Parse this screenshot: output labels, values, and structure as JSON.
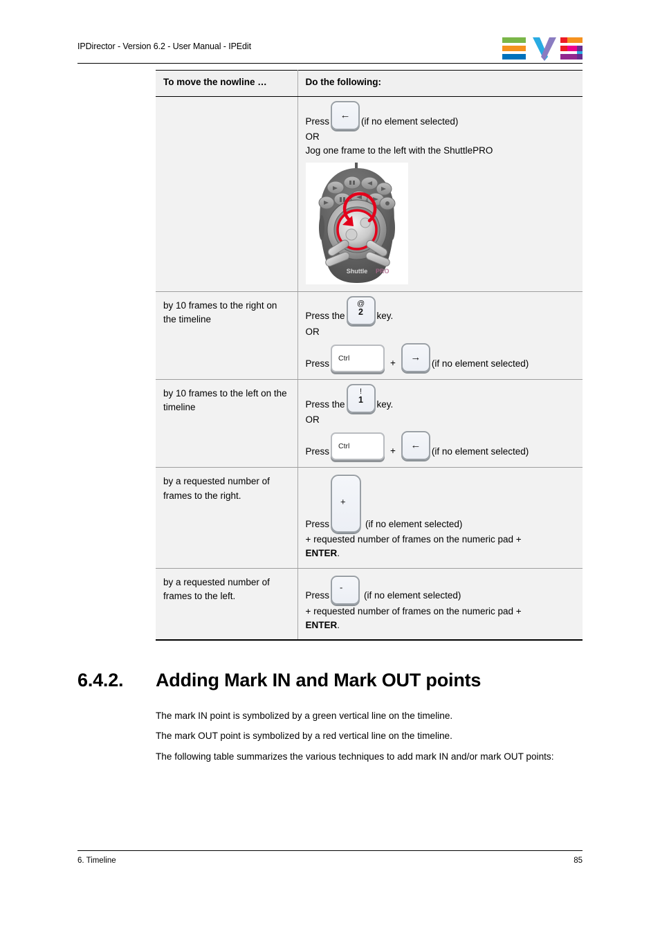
{
  "header": {
    "title": "IPDirector - Version 6.2 - User Manual - IPEdit",
    "logo_name": "EVS",
    "logo_colors": [
      "#7ab648",
      "#f5921e",
      "#0072bc",
      "#29abe2",
      "#8a7cc1",
      "#ed1c24",
      "#ec008c",
      "#f5921e",
      "#92278f",
      "#662d91"
    ]
  },
  "table": {
    "columns": [
      "To move the nowline …",
      "Do the following:"
    ],
    "rows": [
      {
        "action": "",
        "steps": {
          "press_label": "Press",
          "key": "←",
          "key_name": "left-arrow-key",
          "condition": "(if no element selected)",
          "or_label": "OR",
          "alt_text": "Jog one frame to the left with the ShuttlePRO",
          "device_label": "ShuttlePRO"
        }
      },
      {
        "action": "by 10 frames to the right on the timeline",
        "steps": {
          "press_the_label": "Press the",
          "key_top": "@",
          "key_bottom": "2",
          "key_suffix": "key.",
          "or_label": "OR",
          "press_label": "Press",
          "modifier": "Ctrl",
          "plus": "+",
          "key2": "→",
          "condition": "(if no element selected)"
        }
      },
      {
        "action": "by 10 frames to the left on the timeline",
        "steps": {
          "press_the_label": "Press the",
          "key_top": "!",
          "key_bottom": "1",
          "key_suffix": "key.",
          "or_label": "OR",
          "press_label": "Press",
          "modifier": "Ctrl",
          "plus": "+",
          "key2": "←",
          "condition": "(if no element selected)"
        }
      },
      {
        "action": "by a requested number of frames to the right.",
        "steps": {
          "press_label": "Press",
          "key": "+",
          "condition": "(if no element selected)",
          "line2": "+ requested number of frames on the numeric pad +",
          "line3_bold": "ENTER",
          "line3_tail": "."
        }
      },
      {
        "action": "by a requested number of frames to the left.",
        "steps": {
          "press_label": "Press",
          "key": "-",
          "condition": "(if no element selected)",
          "line2": "+ requested number of frames on the numeric pad +",
          "line3_bold": "ENTER",
          "line3_tail": "."
        }
      }
    ]
  },
  "section": {
    "number": "6.4.2.",
    "title": "Adding Mark IN and Mark OUT points",
    "paragraphs": [
      "The mark IN point is symbolized by a green vertical line on the timeline.",
      "The mark OUT point is symbolized by a red vertical line on the timeline.",
      "The following table summarizes the various techniques to add mark IN and/or mark OUT points:"
    ]
  },
  "footer": {
    "chapter": "6. Timeline",
    "page_number": "85"
  }
}
